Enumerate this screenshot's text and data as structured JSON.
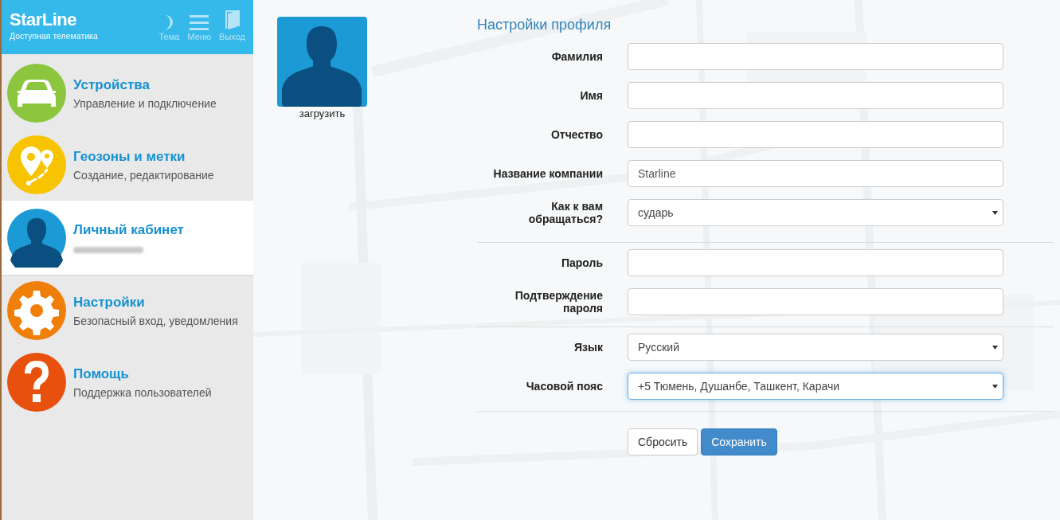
{
  "brand": {
    "name": "StarLine",
    "tagline": "Доступная телематика"
  },
  "header_buttons": [
    {
      "kind": "theme",
      "label": "Тема"
    },
    {
      "kind": "menu",
      "label": "Меню"
    },
    {
      "kind": "exit",
      "label": "Выход"
    }
  ],
  "sidebar": {
    "items": [
      {
        "kind": "car",
        "color": "#8cc63f",
        "title": "Устройства",
        "subtitle": "Управление и подключение",
        "selected": false
      },
      {
        "kind": "pin",
        "color": "#f8c300",
        "title": "Геозоны и метки",
        "subtitle": "Создание, редактирование",
        "selected": false
      },
      {
        "kind": "person",
        "color": "#1c9ad6",
        "title": "Личный кабинет",
        "selected": true,
        "redacted": true
      },
      {
        "kind": "gear",
        "color": "#f07f09",
        "title": "Настройки",
        "subtitle": "Безопасный вход, уведомления",
        "selected": false
      },
      {
        "kind": "help",
        "color": "#e8500e",
        "title": "Помощь",
        "subtitle": "Поддержка пользователей",
        "selected": false
      }
    ]
  },
  "avatar": {
    "upload_label": "загрузить"
  },
  "form": {
    "title": "Настройки профиля",
    "sections": [
      [
        {
          "label": "Фамилия",
          "kind": "text",
          "focused": false
        },
        {
          "label": "Имя",
          "kind": "text",
          "focused": false
        },
        {
          "label": "Отчество",
          "kind": "text",
          "focused": false
        },
        {
          "label": "Название компании",
          "kind": "text",
          "value": "Starline",
          "focused": false
        },
        {
          "label": "Как к вам обращаться?",
          "kind": "select",
          "value": "сударь",
          "focused": false
        }
      ],
      [
        {
          "label": "Пароль",
          "kind": "password",
          "focused": false
        },
        {
          "label": "Подтверждение пароля",
          "kind": "password",
          "focused": false
        }
      ],
      [
        {
          "label": "Язык",
          "kind": "select",
          "value": "Русский",
          "focused": false
        },
        {
          "label": "Часовой пояс",
          "kind": "select",
          "value": "+5 Тюмень, Душанбе, Ташкент, Карачи",
          "focused": true
        }
      ]
    ],
    "buttons": [
      {
        "label": "Сбросить",
        "kind": "default"
      },
      {
        "label": "Сохранить",
        "kind": "primary"
      }
    ]
  }
}
